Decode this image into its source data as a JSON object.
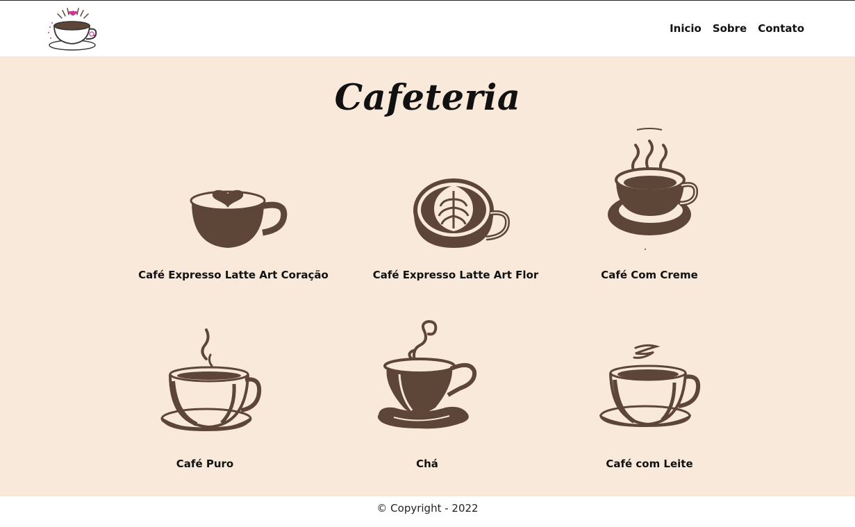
{
  "header": {
    "logo_icon": "coffee-cup-logo-icon",
    "nav": [
      {
        "label": "Inicio"
      },
      {
        "label": "Sobre"
      },
      {
        "label": "Contato"
      }
    ]
  },
  "main": {
    "title": "Cafeteria",
    "products": [
      {
        "name": "Café Expresso Latte Art Coração",
        "icon": "coffee-heart-latte-icon"
      },
      {
        "name": "Café Expresso Latte Art Flor",
        "icon": "coffee-flower-latte-icon"
      },
      {
        "name": "Café Com Creme",
        "icon": "coffee-steam-saucer-icon"
      },
      {
        "name": "Café Puro",
        "icon": "black-coffee-cup-icon"
      },
      {
        "name": "Chá",
        "icon": "teacup-icon"
      },
      {
        "name": "Café com Leite",
        "icon": "coffee-milk-cup-icon"
      }
    ]
  },
  "footer": {
    "copyright": "© Copyright - 2022"
  },
  "colors": {
    "background": "#f8e9da",
    "coffee_brown": "#5d4537",
    "header": "#ffffff",
    "logo_accent": "#d4328f"
  }
}
